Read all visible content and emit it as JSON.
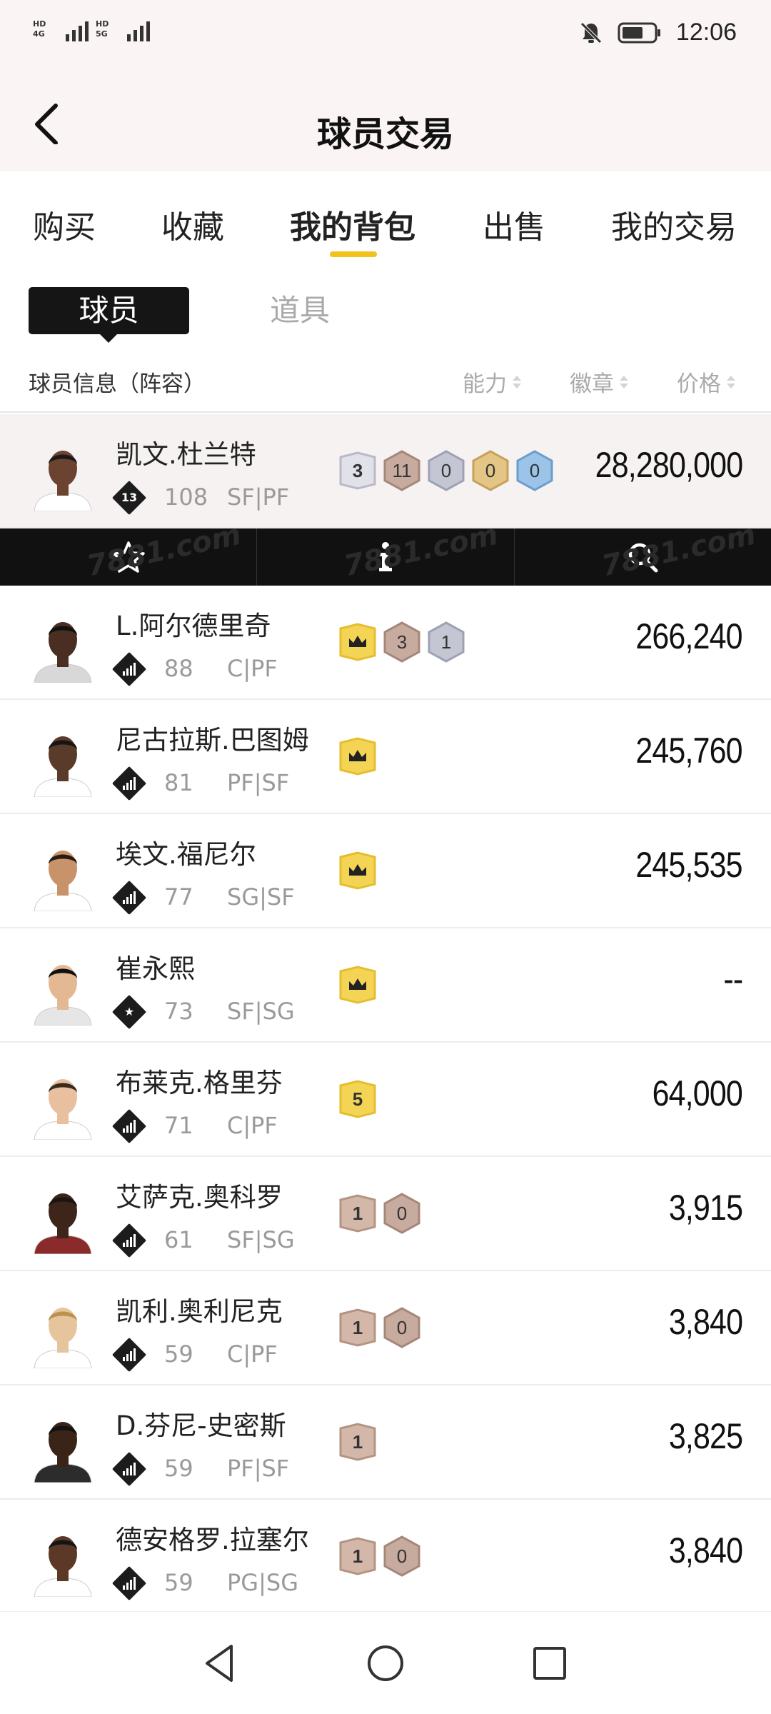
{
  "status_bar": {
    "network_left": "HD 4G",
    "network_right": "HD 5G",
    "time": "12:06"
  },
  "header": {
    "title": "球员交易"
  },
  "main_tabs": [
    {
      "label": "购买"
    },
    {
      "label": "收藏"
    },
    {
      "label": "我的背包",
      "active": true
    },
    {
      "label": "出售"
    },
    {
      "label": "我的交易"
    }
  ],
  "sub_tabs": {
    "player": "球员",
    "prop": "道具"
  },
  "columns": {
    "info": "球员信息（阵容）",
    "ability": "能力",
    "badge": "徽章",
    "price": "价格"
  },
  "colors": {
    "accent": "#f3c11b",
    "dark": "#151515",
    "header_bg": "#fbf4f4"
  },
  "players": [
    {
      "name": "凯文.杜兰特",
      "tier": "13",
      "rating": "108",
      "position": "SF|PF",
      "badges": [
        {
          "v": "3",
          "kind": "silver"
        },
        {
          "v": "11",
          "kind": "bronze"
        },
        {
          "v": "0",
          "kind": "gray"
        },
        {
          "v": "0",
          "kind": "gold"
        },
        {
          "v": "0",
          "kind": "blue"
        }
      ],
      "price": "28,280,000",
      "selected": true
    },
    {
      "name": "L.阿尔德里奇",
      "tier": "",
      "rating": "88",
      "position": "C|PF",
      "badges": [
        {
          "v": "crown",
          "kind": "crown"
        },
        {
          "v": "3",
          "kind": "bronze"
        },
        {
          "v": "1",
          "kind": "gray"
        }
      ],
      "price": "266,240"
    },
    {
      "name": "尼古拉斯.巴图姆",
      "tier": "",
      "rating": "81",
      "position": "PF|SF",
      "badges": [
        {
          "v": "crown",
          "kind": "crown"
        }
      ],
      "price": "245,760"
    },
    {
      "name": "埃文.福尼尔",
      "tier": "",
      "rating": "77",
      "position": "SG|SF",
      "badges": [
        {
          "v": "crown",
          "kind": "crown"
        }
      ],
      "price": "245,535"
    },
    {
      "name": "崔永熙",
      "tier": "star",
      "rating": "73",
      "position": "SF|SG",
      "badges": [
        {
          "v": "crown",
          "kind": "crown"
        }
      ],
      "price": "--"
    },
    {
      "name": "布莱克.格里芬",
      "tier": "",
      "rating": "71",
      "position": "C|PF",
      "badges": [
        {
          "v": "5",
          "kind": "gold5"
        }
      ],
      "price": "64,000"
    },
    {
      "name": "艾萨克.奥科罗",
      "tier": "",
      "rating": "61",
      "position": "SF|SG",
      "badges": [
        {
          "v": "1",
          "kind": "bronzeShield"
        },
        {
          "v": "0",
          "kind": "bronze"
        }
      ],
      "price": "3,915"
    },
    {
      "name": "凯利.奥利尼克",
      "tier": "",
      "rating": "59",
      "position": "C|PF",
      "badges": [
        {
          "v": "1",
          "kind": "bronzeShield"
        },
        {
          "v": "0",
          "kind": "bronze"
        }
      ],
      "price": "3,840"
    },
    {
      "name": "D.芬尼-史密斯",
      "tier": "",
      "rating": "59",
      "position": "PF|SF",
      "badges": [
        {
          "v": "1",
          "kind": "bronzeShield"
        }
      ],
      "price": "3,825"
    },
    {
      "name": "德安格罗.拉塞尔",
      "tier": "",
      "rating": "59",
      "position": "PG|SG",
      "badges": [
        {
          "v": "1",
          "kind": "bronzeShield"
        },
        {
          "v": "0",
          "kind": "bronze"
        }
      ],
      "price": "3,840"
    }
  ],
  "action_bar": {
    "icons": [
      "star-icon",
      "info-icon",
      "search-icon"
    ],
    "watermark": "7881.com"
  },
  "nav_bar": {
    "icons": [
      "back-triangle-icon",
      "home-circle-icon",
      "recents-square-icon"
    ]
  }
}
